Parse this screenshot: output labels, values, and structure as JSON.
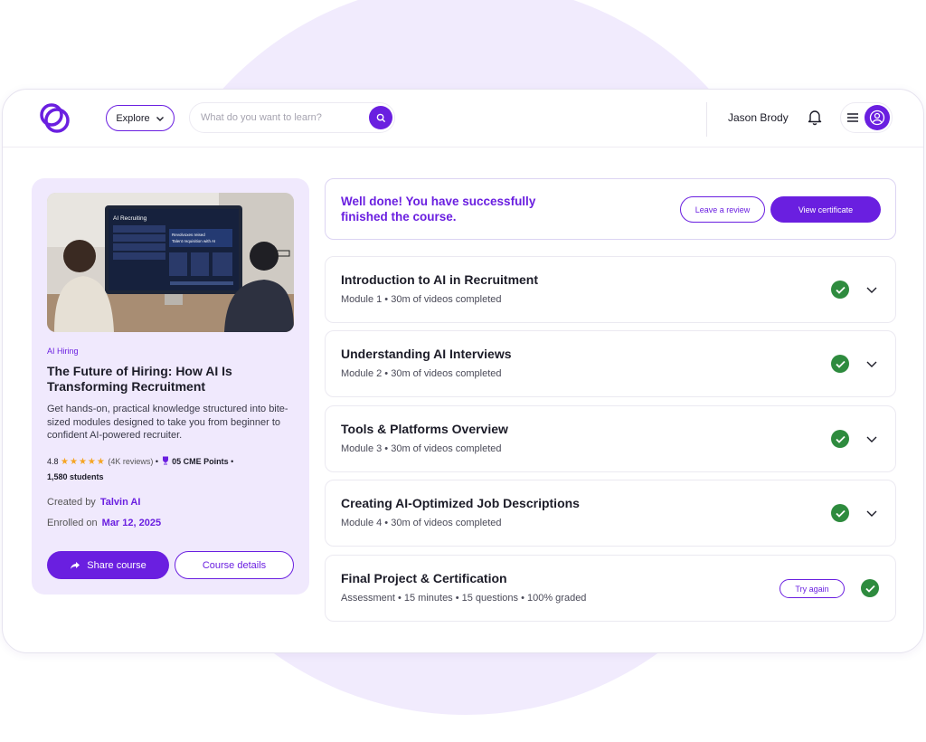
{
  "header": {
    "explore_label": "Explore",
    "search_placeholder": "What do you want to learn?",
    "user_name": "Jason Brody"
  },
  "course": {
    "tag": "AI Hiring",
    "title": "The Future of Hiring: How AI Is Transforming Recruitment",
    "description": "Get hands-on, practical knowledge structured into bite-sized modules designed to take you from beginner to confident AI-powered recruiter.",
    "rating": "4.8",
    "stars": "★★★★★",
    "reviews": "(4K reviews)",
    "points": "05 CME Points",
    "students": "1,580 students",
    "created_label": "Created by",
    "created_value": "Talvin AI",
    "enrolled_label": "Enrolled on",
    "enrolled_value": "Mar 12, 2025",
    "share_label": "Share course",
    "details_label": "Course details",
    "image": {
      "screen_title": "AI Recruiting",
      "screen_headline": "Revolvoxes reised Talent requisition with AI"
    }
  },
  "banner": {
    "message": "Well done! You have successfully finished the course.",
    "review_label": "Leave a review",
    "certificate_label": "View certificate"
  },
  "modules": [
    {
      "title": "Introduction to AI in Recruitment",
      "subtitle": "Module 1 • 30m of videos completed"
    },
    {
      "title": "Understanding AI Interviews",
      "subtitle": "Module 2 • 30m of videos completed"
    },
    {
      "title": "Tools & Platforms Overview",
      "subtitle": "Module 3 • 30m of videos completed"
    },
    {
      "title": "Creating AI-Optimized Job Descriptions",
      "subtitle": "Module 4 • 30m of videos completed"
    }
  ],
  "final_project": {
    "title": "Final Project & Certification",
    "subtitle": "Assessment • 15 minutes • 15 questions • 100% graded",
    "try_label": "Try again"
  },
  "colors": {
    "accent": "#6a1fe0",
    "card_bg": "#f0e9fd",
    "success": "#2e8b3e",
    "star": "#f5a524"
  },
  "icons": [
    "logo-icon",
    "chevron-down-icon",
    "search-icon",
    "bell-icon",
    "menu-icon",
    "user-icon",
    "share-icon",
    "check-icon",
    "trophy-icon"
  ]
}
